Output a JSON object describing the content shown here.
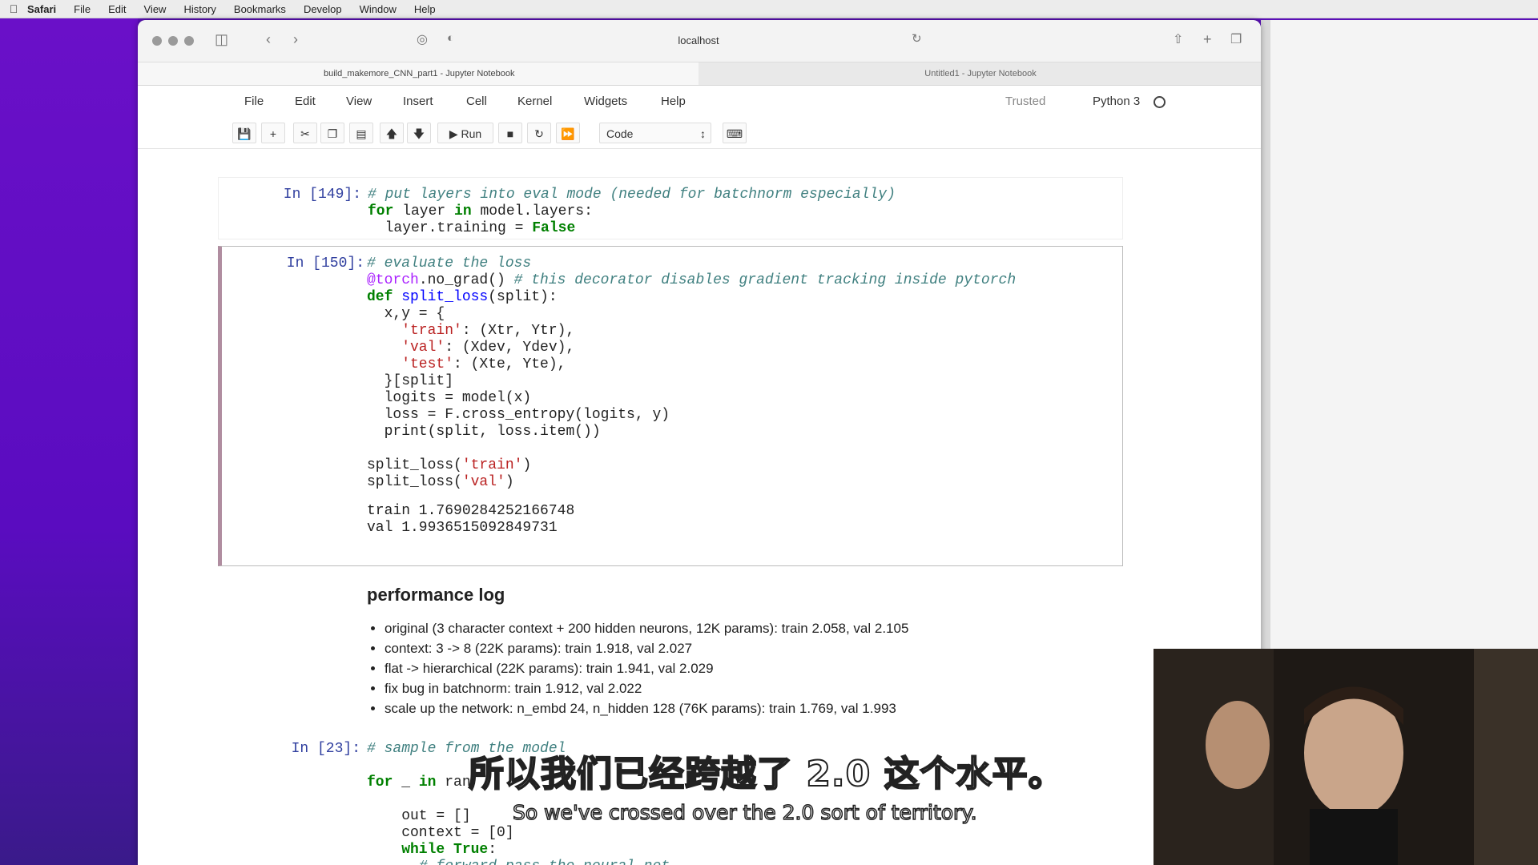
{
  "menubar": {
    "apple": "",
    "app": "Safari",
    "items": [
      "File",
      "Edit",
      "View",
      "History",
      "Bookmarks",
      "Develop",
      "Window",
      "Help"
    ]
  },
  "browser": {
    "address": "localhost",
    "tabs": [
      {
        "label": "build_makemore_CNN_part1 - Jupyter Notebook"
      },
      {
        "label": "Untitled1 - Jupyter Notebook"
      }
    ]
  },
  "jupyter": {
    "menu": [
      "File",
      "Edit",
      "View",
      "Insert",
      "Cell",
      "Kernel",
      "Widgets",
      "Help"
    ],
    "trusted": "Trusted",
    "kernel": "Python 3",
    "toolbar": {
      "run_label": "Run",
      "cell_type": "Code"
    }
  },
  "cells": {
    "c149": {
      "prompt": "In [149]:",
      "line1": "# put layers into eval mode (needed for batchnorm especially)",
      "line2_kw": "for",
      "line2_mid": " layer ",
      "line2_in": "in",
      "line2_rest": " model.layers:",
      "line3": "  layer.training = ",
      "line3_false": "False"
    },
    "c150": {
      "prompt": "In [150]:",
      "l1": "# evaluate the loss",
      "l2_dec": "@torch",
      "l2_mid": ".no_grad() ",
      "l2_cm": "# this decorator disables gradient tracking inside pytorch",
      "l3_def": "def",
      "l3_name": " split_loss",
      "l3_rest": "(split):",
      "l4": "  x,y = {",
      "l5_s": "    'train'",
      "l5_r": ": (Xtr, Ytr),",
      "l6_s": "    'val'",
      "l6_r": ": (Xdev, Ydev),",
      "l7_s": "    'test'",
      "l7_r": ": (Xte, Yte),",
      "l8": "  }[split]",
      "l9": "  logits = model(x)",
      "l10": "  loss = F.cross_entropy(logits, y)",
      "l11": "  print(split, loss.item())",
      "l12a": "split_loss(",
      "l12s": "'train'",
      "l12b": ")",
      "l13a": "split_loss(",
      "l13s": "'val'",
      "l13b": ")",
      "out1": "train 1.7690284252166748",
      "out2": "val 1.9936515092849731"
    },
    "md": {
      "heading": "performance log",
      "items": [
        "original (3 character context + 200 hidden neurons, 12K params): train 2.058, val 2.105",
        "context: 3 -> 8 (22K params): train 1.918, val 2.027",
        "flat -> hierarchical (22K params): train 1.941, val 2.029",
        "fix bug in batchnorm: train 1.912, val 2.022",
        "scale up the network: n_embd 24, n_hidden 128 (76K params): train 1.769, val 1.993"
      ]
    },
    "c23": {
      "prompt": "In [23]:",
      "l1": "# sample from the model",
      "l2_kw": "for",
      "l2_rest": " _ ",
      "l2_in": "in",
      "l2_tail": " ran",
      "l3": "    out = []",
      "l4": "    context = [0]",
      "l5_kw": "    while",
      "l5_true": " True",
      "l5_rest": ":",
      "l6": "      # forward pass the neural net"
    }
  },
  "subtitles": {
    "zh": "所以我们已经跨越了 2.0 这个水平。",
    "en": "So we've crossed over the 2.0 sort of territory."
  }
}
